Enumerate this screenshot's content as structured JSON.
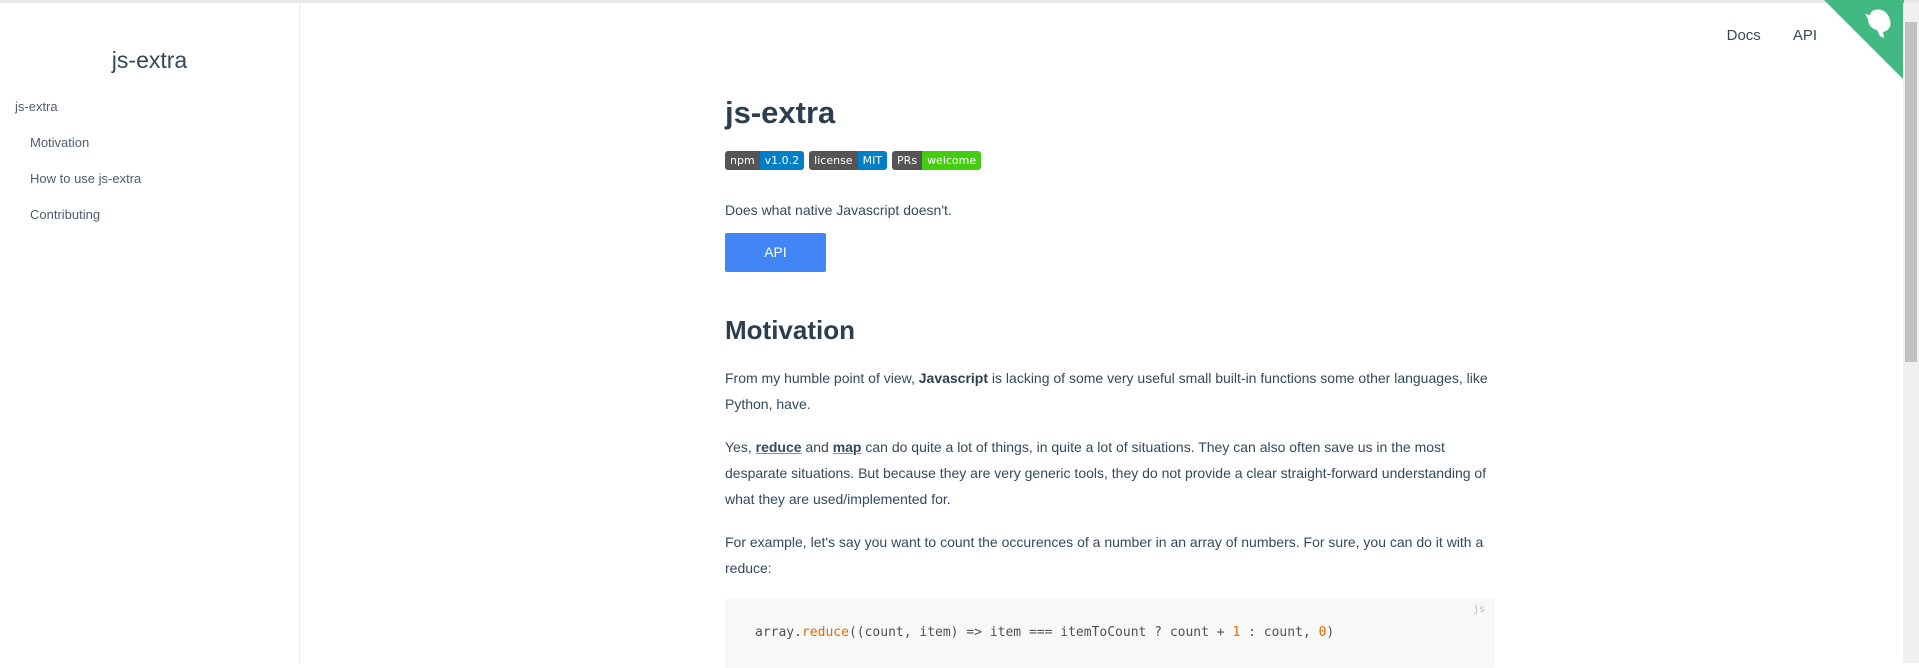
{
  "sidebar": {
    "app_name": "js-extra",
    "items": [
      {
        "label": "js-extra",
        "level": 0
      },
      {
        "label": "Motivation",
        "level": 1
      },
      {
        "label": "How to use js-extra",
        "level": 1
      },
      {
        "label": "Contributing",
        "level": 1
      }
    ]
  },
  "top_nav": {
    "docs": "Docs",
    "api": "API",
    "corner_color": "#42b983"
  },
  "content": {
    "title": "js-extra",
    "badges": [
      {
        "left": "npm",
        "right": "v1.0.2",
        "color": "#007ec6"
      },
      {
        "left": "license",
        "right": "MIT",
        "color": "#007ec6"
      },
      {
        "left": "PRs",
        "right": "welcome",
        "color": "#4c1"
      }
    ],
    "tagline": "Does what native Javascript doesn't.",
    "api_button": "API",
    "motivation_heading": "Motivation",
    "p1": {
      "a": "From my humble point of view, ",
      "bold": "Javascript",
      "b": " is lacking of some very useful small built-in functions some other languages, like Python, have."
    },
    "p2": {
      "a": "Yes, ",
      "link1": "reduce",
      "b": " and ",
      "link2": "map",
      "c": " can do quite a lot of things, in quite a lot of situations. They can also often save us in the most desparate situations. But because they are very generic tools, they do not provide a clear straight-forward understanding of what they are used/implemented for."
    },
    "p3": "For example, let's say you want to count the occurences of a number in an array of numbers. For sure, you can do it with a reduce:",
    "code": {
      "lang": "js",
      "t1": "array.",
      "fn": "reduce",
      "t2": "((count, item) => item === itemToCount ? count + ",
      "n1": "1",
      "t3": " : count, ",
      "n2": "0",
      "t4": ")"
    }
  }
}
